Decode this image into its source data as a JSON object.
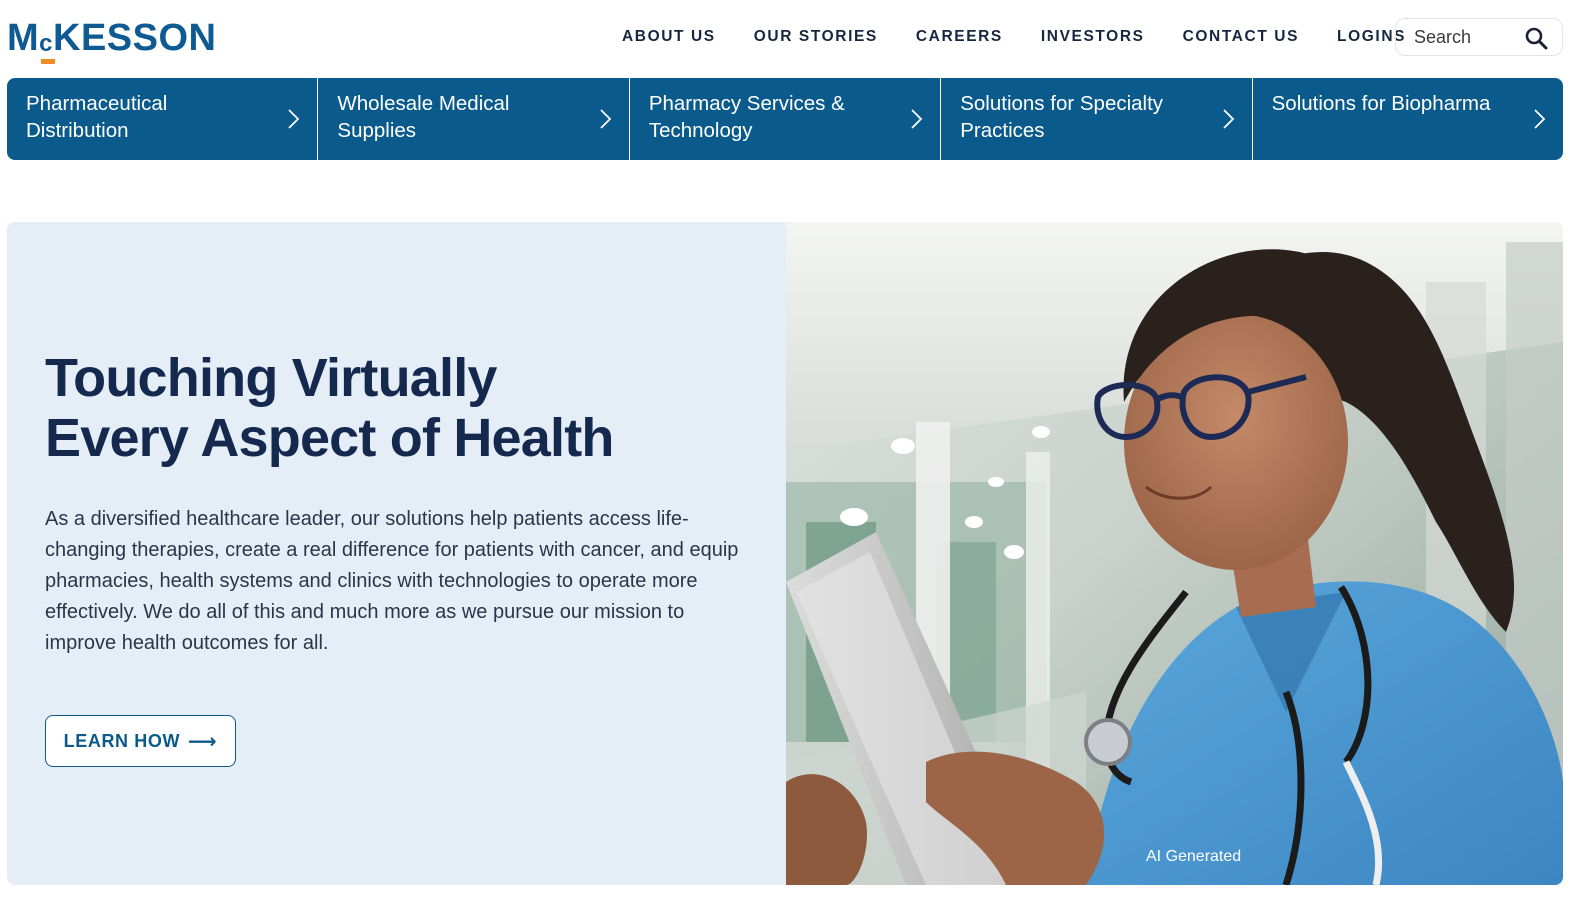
{
  "brand": {
    "logo_text_pre": "M",
    "logo_text_c": "c",
    "logo_text_post": "KESSON",
    "accent_color": "#f08a24",
    "primary_color": "#0a5a8c"
  },
  "top_nav": {
    "items": [
      {
        "label": "ABOUT US"
      },
      {
        "label": "OUR STORIES"
      },
      {
        "label": "CAREERS"
      },
      {
        "label": "INVESTORS"
      },
      {
        "label": "CONTACT US"
      },
      {
        "label": "LOGINS"
      }
    ]
  },
  "search": {
    "placeholder": "Search",
    "icon": "search-icon"
  },
  "categories": {
    "items": [
      {
        "label": "Pharmaceutical Distribution",
        "icon": "chevron-right-icon"
      },
      {
        "label": "Wholesale Medical Supplies",
        "icon": "chevron-right-icon"
      },
      {
        "label": "Pharmacy Services & Technology",
        "icon": "chevron-right-icon"
      },
      {
        "label": "Solutions for Specialty Practices",
        "icon": "chevron-right-icon"
      },
      {
        "label": "Solutions for Biopharma",
        "icon": "chevron-right-icon"
      }
    ]
  },
  "hero": {
    "title_line1": "Touching Virtually",
    "title_line2": "Every Aspect of Health",
    "body": "As a diversified healthcare leader, our solutions help patients access life-changing therapies, create a real difference for patients with cancer, and equip pharmacies, health systems and clinics with technologies to operate more effectively. We do all of this and much more as we pursue our mission to improve health outcomes for all.",
    "cta_label": "LEARN HOW",
    "cta_icon": "arrow-right-icon",
    "image_caption": "AI Generated",
    "background_color": "#e5eef7"
  }
}
